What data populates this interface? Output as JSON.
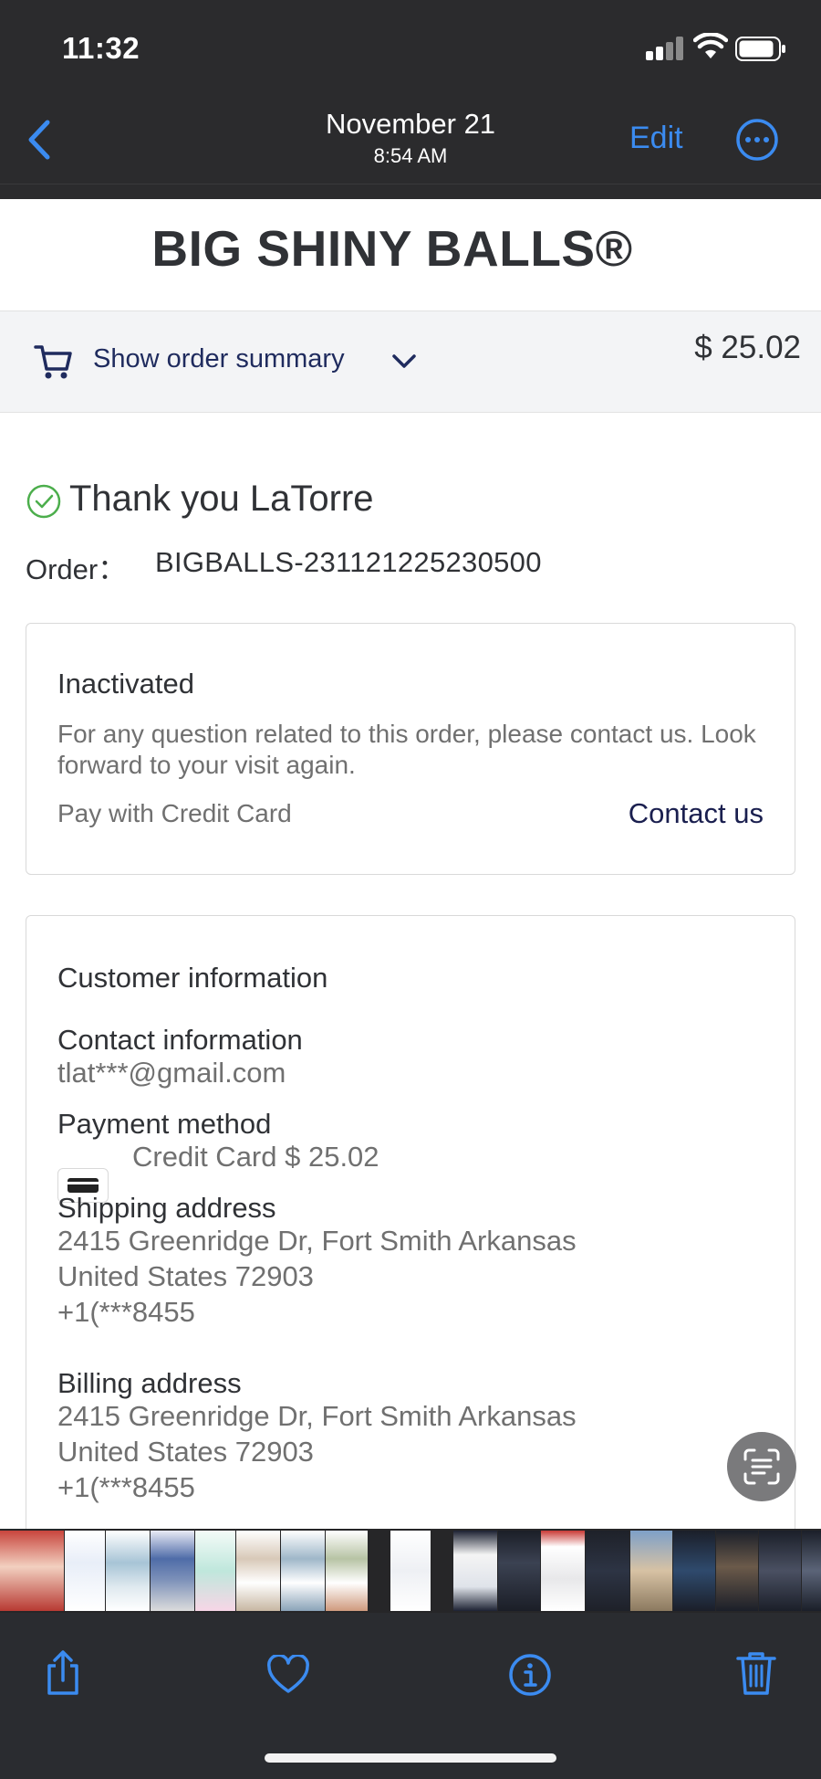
{
  "status_bar": {
    "time": "11:32"
  },
  "nav": {
    "date": "November 21",
    "time": "8:54 AM",
    "edit_label": "Edit"
  },
  "store": {
    "brand": "BIG SHINY BALLS®"
  },
  "summary": {
    "toggle_label": "Show order summary",
    "total": "$ 25.02"
  },
  "order": {
    "thanks": "Thank you LaTorre",
    "order_label": "Order：",
    "order_number": "BIGBALLS-231121225230500"
  },
  "status_card": {
    "title": "Inactivated",
    "message": "For any question related to this order, please contact us. Look forward to your visit again.",
    "payment_note": "Pay with Credit Card",
    "contact_label": "Contact us"
  },
  "customer": {
    "title": "Customer information",
    "contact_label": "Contact information",
    "email": "tlat***@gmail.com",
    "payment_label": "Payment method",
    "payment_value": "Credit Card $ 25.02",
    "shipping_label": "Shipping address",
    "shipping_line1": "2415 Greenridge Dr, Fort Smith Arkansas",
    "shipping_line2": "United States 72903",
    "shipping_phone": "+1(***8455",
    "billing_label": "Billing address",
    "billing_line1": "2415 Greenridge Dr, Fort Smith Arkansas",
    "billing_line2": "United States 72903",
    "billing_phone": "+1(***8455"
  },
  "icons": {
    "back": "chevron-left-icon",
    "more": "ellipsis-circle-icon",
    "cart": "cart-icon",
    "check": "check-circle-icon",
    "live_text": "live-text-icon",
    "share": "share-icon",
    "favorite": "heart-icon",
    "info": "info-icon",
    "delete": "trash-icon"
  },
  "colors": {
    "accent": "#3b8bf0",
    "chrome": "#2b2b2d",
    "success": "#4cae4c",
    "link": "#1a1f4f"
  }
}
